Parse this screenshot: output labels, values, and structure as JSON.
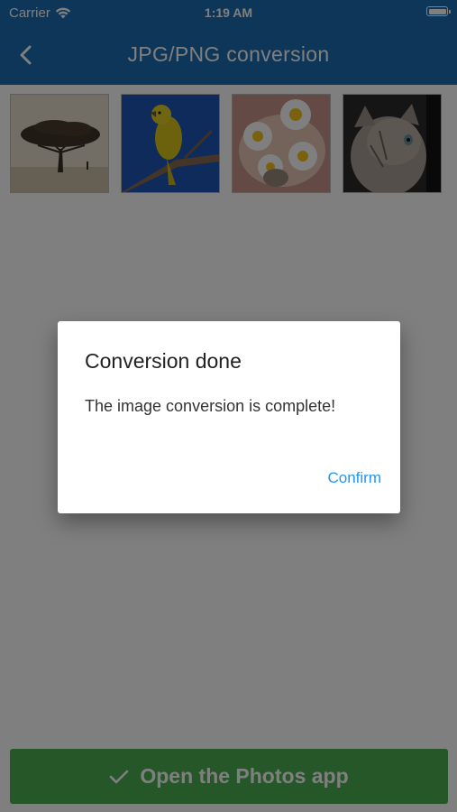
{
  "status_bar": {
    "carrier": "Carrier",
    "time": "1:19 AM"
  },
  "nav": {
    "title": "JPG/PNG conversion",
    "back_icon": "chevron-left-icon"
  },
  "thumbnails": [
    {
      "name": "tree-photo"
    },
    {
      "name": "yellow-bird-photo"
    },
    {
      "name": "daisies-photo"
    },
    {
      "name": "kitten-photo"
    }
  ],
  "primary_button": {
    "label": "Open the Photos app",
    "icon": "checkmark-icon"
  },
  "dialog": {
    "title": "Conversion done",
    "message": "The image conversion is complete!",
    "confirm_label": "Confirm"
  },
  "colors": {
    "nav_bar": "#1a6cb3",
    "primary_button": "#4caf50",
    "dialog_confirm": "#2196f3",
    "overlay": "rgba(0,0,0,0.5)"
  }
}
